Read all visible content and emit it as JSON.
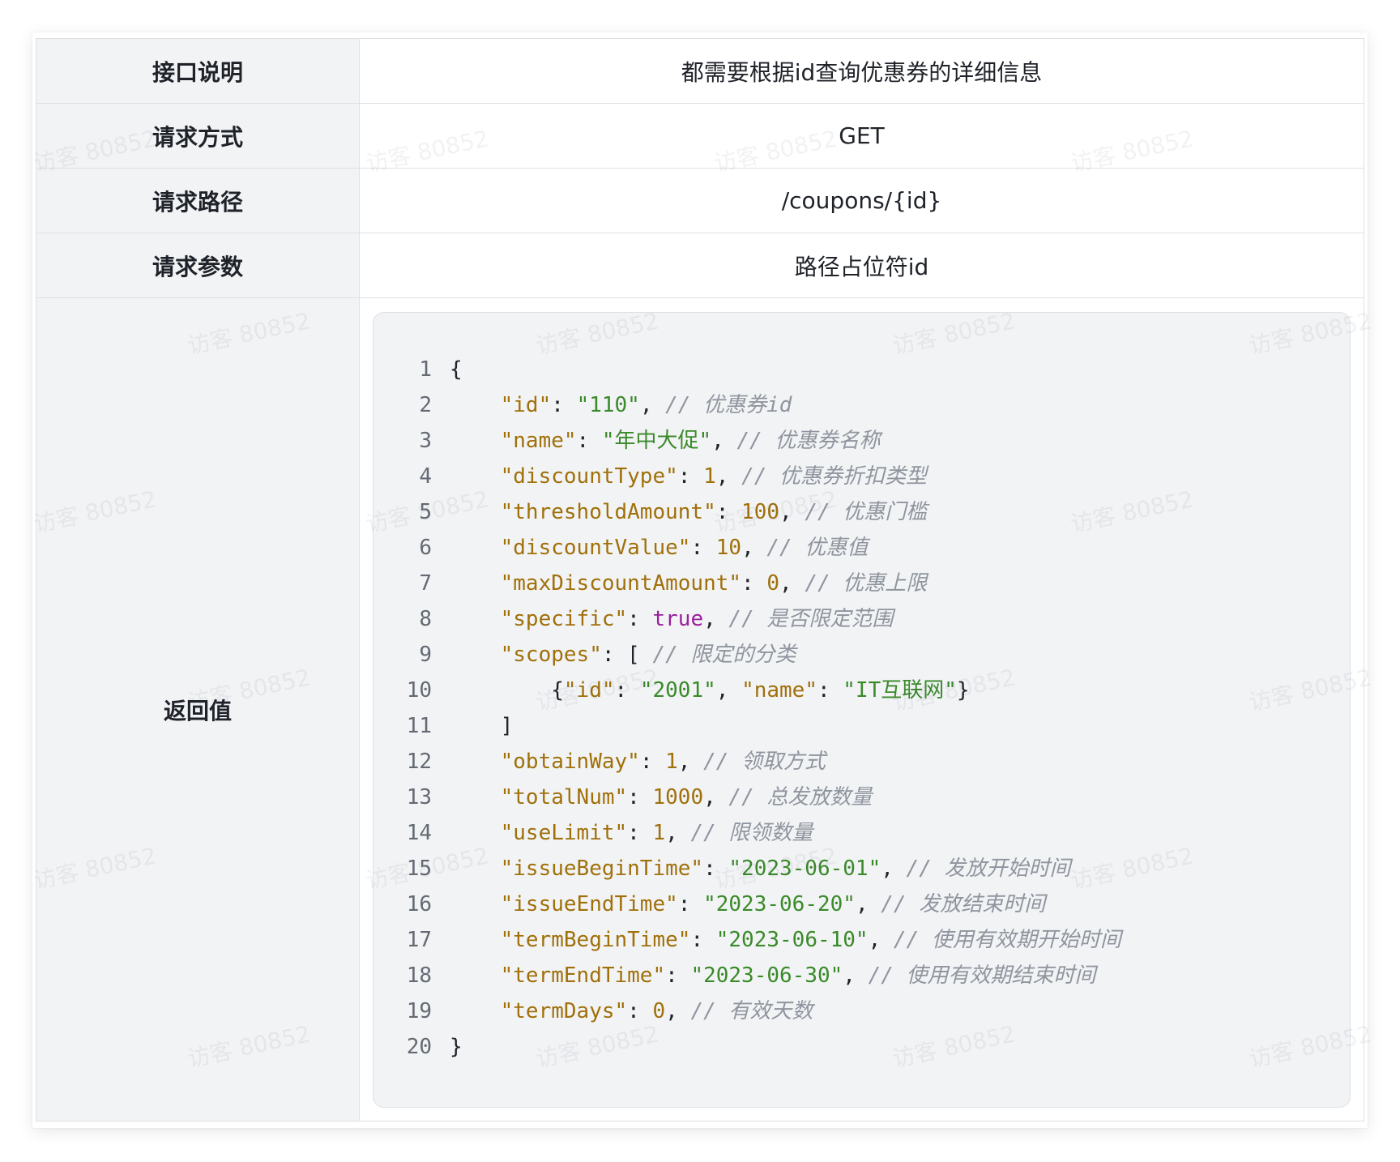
{
  "rows": [
    {
      "key": "接口说明",
      "value": "都需要根据id查询优惠券的详细信息"
    },
    {
      "key": "请求方式",
      "value": "GET"
    },
    {
      "key": "请求路径",
      "value": "/coupons/{id}"
    },
    {
      "key": "请求参数",
      "value": "路径占位符id"
    }
  ],
  "return_row": {
    "key": "返回值"
  },
  "code": [
    {
      "n": "1",
      "tokens": [
        {
          "t": "{",
          "c": "p"
        }
      ]
    },
    {
      "n": "2",
      "tokens": [
        {
          "t": "    ",
          "c": "p"
        },
        {
          "t": "\"id\"",
          "c": "k"
        },
        {
          "t": ": ",
          "c": "p"
        },
        {
          "t": "\"110\"",
          "c": "s"
        },
        {
          "t": ", ",
          "c": "p"
        },
        {
          "t": "// 优惠券id",
          "c": "c"
        }
      ]
    },
    {
      "n": "3",
      "tokens": [
        {
          "t": "    ",
          "c": "p"
        },
        {
          "t": "\"name\"",
          "c": "k"
        },
        {
          "t": ": ",
          "c": "p"
        },
        {
          "t": "\"年中大促\"",
          "c": "s"
        },
        {
          "t": ", ",
          "c": "p"
        },
        {
          "t": "// 优惠券名称",
          "c": "c"
        }
      ]
    },
    {
      "n": "4",
      "tokens": [
        {
          "t": "    ",
          "c": "p"
        },
        {
          "t": "\"discountType\"",
          "c": "k"
        },
        {
          "t": ": ",
          "c": "p"
        },
        {
          "t": "1",
          "c": "n"
        },
        {
          "t": ", ",
          "c": "p"
        },
        {
          "t": "// 优惠券折扣类型",
          "c": "c"
        }
      ]
    },
    {
      "n": "5",
      "tokens": [
        {
          "t": "    ",
          "c": "p"
        },
        {
          "t": "\"thresholdAmount\"",
          "c": "k"
        },
        {
          "t": ": ",
          "c": "p"
        },
        {
          "t": "100",
          "c": "n"
        },
        {
          "t": ", ",
          "c": "p"
        },
        {
          "t": "// 优惠门槛",
          "c": "c"
        }
      ]
    },
    {
      "n": "6",
      "tokens": [
        {
          "t": "    ",
          "c": "p"
        },
        {
          "t": "\"discountValue\"",
          "c": "k"
        },
        {
          "t": ": ",
          "c": "p"
        },
        {
          "t": "10",
          "c": "n"
        },
        {
          "t": ", ",
          "c": "p"
        },
        {
          "t": "// 优惠值",
          "c": "c"
        }
      ]
    },
    {
      "n": "7",
      "tokens": [
        {
          "t": "    ",
          "c": "p"
        },
        {
          "t": "\"maxDiscountAmount\"",
          "c": "k"
        },
        {
          "t": ": ",
          "c": "p"
        },
        {
          "t": "0",
          "c": "n"
        },
        {
          "t": ", ",
          "c": "p"
        },
        {
          "t": "// 优惠上限",
          "c": "c"
        }
      ]
    },
    {
      "n": "8",
      "tokens": [
        {
          "t": "    ",
          "c": "p"
        },
        {
          "t": "\"specific\"",
          "c": "k"
        },
        {
          "t": ": ",
          "c": "p"
        },
        {
          "t": "true",
          "c": "b"
        },
        {
          "t": ", ",
          "c": "p"
        },
        {
          "t": "// 是否限定范围",
          "c": "c"
        }
      ]
    },
    {
      "n": "9",
      "tokens": [
        {
          "t": "    ",
          "c": "p"
        },
        {
          "t": "\"scopes\"",
          "c": "k"
        },
        {
          "t": ": [ ",
          "c": "p"
        },
        {
          "t": "// 限定的分类",
          "c": "c"
        }
      ]
    },
    {
      "n": "10",
      "tokens": [
        {
          "t": "        {",
          "c": "p"
        },
        {
          "t": "\"id\"",
          "c": "k"
        },
        {
          "t": ": ",
          "c": "p"
        },
        {
          "t": "\"2001\"",
          "c": "s"
        },
        {
          "t": ", ",
          "c": "p"
        },
        {
          "t": "\"name\"",
          "c": "k"
        },
        {
          "t": ": ",
          "c": "p"
        },
        {
          "t": "\"IT互联网\"",
          "c": "s"
        },
        {
          "t": "}",
          "c": "p"
        }
      ]
    },
    {
      "n": "11",
      "tokens": [
        {
          "t": "    ]",
          "c": "p"
        }
      ]
    },
    {
      "n": "12",
      "tokens": [
        {
          "t": "    ",
          "c": "p"
        },
        {
          "t": "\"obtainWay\"",
          "c": "k"
        },
        {
          "t": ": ",
          "c": "p"
        },
        {
          "t": "1",
          "c": "n"
        },
        {
          "t": ", ",
          "c": "p"
        },
        {
          "t": "// 领取方式",
          "c": "c"
        }
      ]
    },
    {
      "n": "13",
      "tokens": [
        {
          "t": "    ",
          "c": "p"
        },
        {
          "t": "\"totalNum\"",
          "c": "k"
        },
        {
          "t": ": ",
          "c": "p"
        },
        {
          "t": "1000",
          "c": "n"
        },
        {
          "t": ", ",
          "c": "p"
        },
        {
          "t": "// 总发放数量",
          "c": "c"
        }
      ]
    },
    {
      "n": "14",
      "tokens": [
        {
          "t": "    ",
          "c": "p"
        },
        {
          "t": "\"useLimit\"",
          "c": "k"
        },
        {
          "t": ": ",
          "c": "p"
        },
        {
          "t": "1",
          "c": "n"
        },
        {
          "t": ", ",
          "c": "p"
        },
        {
          "t": "// 限领数量",
          "c": "c"
        }
      ]
    },
    {
      "n": "15",
      "tokens": [
        {
          "t": "    ",
          "c": "p"
        },
        {
          "t": "\"issueBeginTime\"",
          "c": "k"
        },
        {
          "t": ": ",
          "c": "p"
        },
        {
          "t": "\"2023-06-01\"",
          "c": "s"
        },
        {
          "t": ", ",
          "c": "p"
        },
        {
          "t": "// 发放开始时间",
          "c": "c"
        }
      ]
    },
    {
      "n": "16",
      "tokens": [
        {
          "t": "    ",
          "c": "p"
        },
        {
          "t": "\"issueEndTime\"",
          "c": "k"
        },
        {
          "t": ": ",
          "c": "p"
        },
        {
          "t": "\"2023-06-20\"",
          "c": "s"
        },
        {
          "t": ", ",
          "c": "p"
        },
        {
          "t": "// 发放结束时间",
          "c": "c"
        }
      ]
    },
    {
      "n": "17",
      "tokens": [
        {
          "t": "    ",
          "c": "p"
        },
        {
          "t": "\"termBeginTime\"",
          "c": "k"
        },
        {
          "t": ": ",
          "c": "p"
        },
        {
          "t": "\"2023-06-10\"",
          "c": "s"
        },
        {
          "t": ", ",
          "c": "p"
        },
        {
          "t": "// 使用有效期开始时间",
          "c": "c"
        }
      ]
    },
    {
      "n": "18",
      "tokens": [
        {
          "t": "    ",
          "c": "p"
        },
        {
          "t": "\"termEndTime\"",
          "c": "k"
        },
        {
          "t": ": ",
          "c": "p"
        },
        {
          "t": "\"2023-06-30\"",
          "c": "s"
        },
        {
          "t": ", ",
          "c": "p"
        },
        {
          "t": "// 使用有效期结束时间",
          "c": "c"
        }
      ]
    },
    {
      "n": "19",
      "tokens": [
        {
          "t": "    ",
          "c": "p"
        },
        {
          "t": "\"termDays\"",
          "c": "k"
        },
        {
          "t": ": ",
          "c": "p"
        },
        {
          "t": "0",
          "c": "n"
        },
        {
          "t": ", ",
          "c": "p"
        },
        {
          "t": "// 有效天数",
          "c": "c"
        }
      ]
    },
    {
      "n": "20",
      "tokens": [
        {
          "t": "}",
          "c": "p"
        }
      ]
    }
  ],
  "watermark_text": "访客 80852",
  "colors": {
    "key_cell_bg": "#f2f3f5",
    "border": "#dee0e3",
    "json_key": "#a0700a",
    "json_string": "#3a8a2a",
    "json_boolean": "#9a1f9e",
    "comment": "#8f959e"
  }
}
